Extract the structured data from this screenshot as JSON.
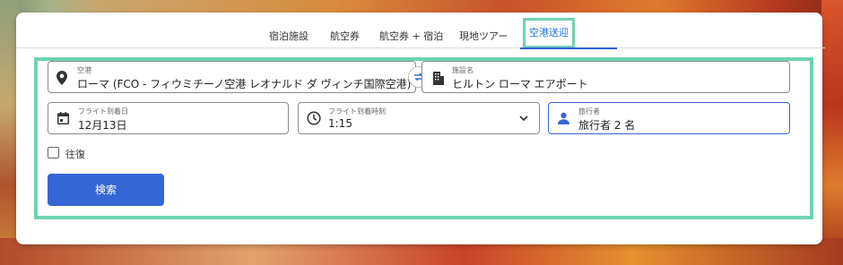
{
  "tabs": {
    "items": [
      {
        "label": "宿泊施設"
      },
      {
        "label": "航空券"
      },
      {
        "label": "航空券 + 宿泊"
      },
      {
        "label": "現地ツアー"
      }
    ],
    "active_label": "空港送迎"
  },
  "airport": {
    "label": "空港",
    "value": "ローマ (FCO - フィウミチーノ空港 レオナルド ダ ヴィンチ国際空港)"
  },
  "hotel": {
    "label": "施設名",
    "value": "ヒルトン ローマ エアポート"
  },
  "arrival_date": {
    "label": "フライト到着日",
    "value": "12月13日"
  },
  "arrival_time": {
    "label": "フライト到着時刻",
    "value": "1:15"
  },
  "travelers": {
    "label": "旅行者",
    "value": "旅行者 2 名"
  },
  "round_trip": {
    "label": "往復",
    "checked": false
  },
  "search_button": {
    "label": "検索"
  },
  "colors": {
    "accent": "#3566d6",
    "highlight": "#6ed3b0",
    "active_tab_text": "#1a73e8"
  },
  "icons": {
    "airport": "map-pin-icon",
    "swap": "swap-arrows-icon",
    "hotel": "building-icon",
    "date": "calendar-icon",
    "time": "clock-icon",
    "time_dropdown": "chevron-down-icon",
    "travelers": "person-icon"
  }
}
